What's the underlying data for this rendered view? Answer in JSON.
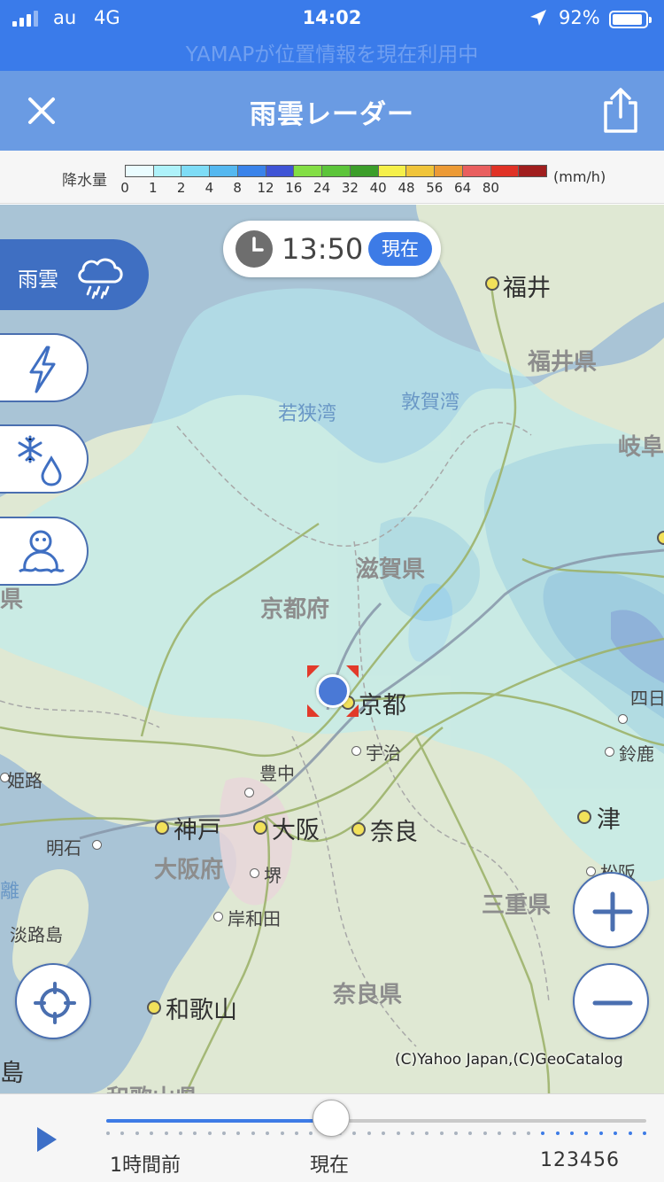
{
  "status_bar": {
    "carrier": "au",
    "network": "4G",
    "time": "14:02",
    "battery_percent": "92%",
    "battery_level": 0.92,
    "location_banner": "YAMAPが位置情報を現在利用中"
  },
  "nav": {
    "title": "雨雲レーダー",
    "close_icon": "close-icon",
    "share_icon": "share-icon"
  },
  "legend": {
    "label": "降水量",
    "unit": "(mm/h)",
    "ticks": [
      "0",
      "1",
      "2",
      "4",
      "8",
      "12",
      "16",
      "24",
      "32",
      "40",
      "48",
      "56",
      "64",
      "80"
    ],
    "colors": [
      "#eafcff",
      "#aef2fa",
      "#7edcf6",
      "#55b8f0",
      "#3a83ea",
      "#3f54d6",
      "#83de45",
      "#5cc53a",
      "#3c9e2a",
      "#f5f04a",
      "#f0c43a",
      "#ec9a35",
      "#e95f5f",
      "#e03226",
      "#a01e1e"
    ]
  },
  "map": {
    "time": "13:50",
    "now_badge": "現在",
    "layers": {
      "rain": "雨雲",
      "rain_icon": "cloud-rain-icon",
      "lightning_icon": "lightning-icon",
      "snow_icon": "snow-drop-icon",
      "snowman_icon": "snowman-icon"
    },
    "labels": {
      "fukui": "福井",
      "fukui_pref": "福井県",
      "gifu_partial": "岐阜",
      "wakasa_bay": "若狭湾",
      "tsuruga_bay": "敦賀湾",
      "shiga_pref": "滋賀県",
      "kyoto_pref": "京都府",
      "kyoto": "京都",
      "uji": "宇治",
      "toyonaka": "豊中",
      "himeji": "姫路",
      "kobe": "神戸",
      "osaka": "大阪",
      "nara": "奈良",
      "akashi": "明石",
      "osaka_pref": "大阪府",
      "sakai": "堺",
      "kishiwada": "岸和田",
      "awaji": "淡路島",
      "wakayama": "和歌山",
      "nara_pref": "奈良県",
      "mie_pref": "三重県",
      "tsu": "津",
      "suzuka": "鈴鹿",
      "yokkaichi_partial": "四日",
      "matsusaka_partial": "松阪",
      "left_edge_1": "県",
      "left_edge_2": "離",
      "left_edge_3": "島",
      "wakayama_pref_partial": "和歌山県"
    },
    "copyright": "(C)Yahoo Japan,(C)GeoCatalog",
    "zoom_in_icon": "plus-icon",
    "zoom_out_icon": "minus-icon",
    "locate_icon": "crosshair-icon"
  },
  "timeline": {
    "play_icon": "play-icon",
    "left_label": "1時間前",
    "center_label": "現在",
    "right_label": "123456",
    "position_fraction": 0.417
  },
  "colors": {
    "status_bar": "#3a7bea",
    "nav_bar": "#6a9be3",
    "accent": "#3d7be6"
  }
}
